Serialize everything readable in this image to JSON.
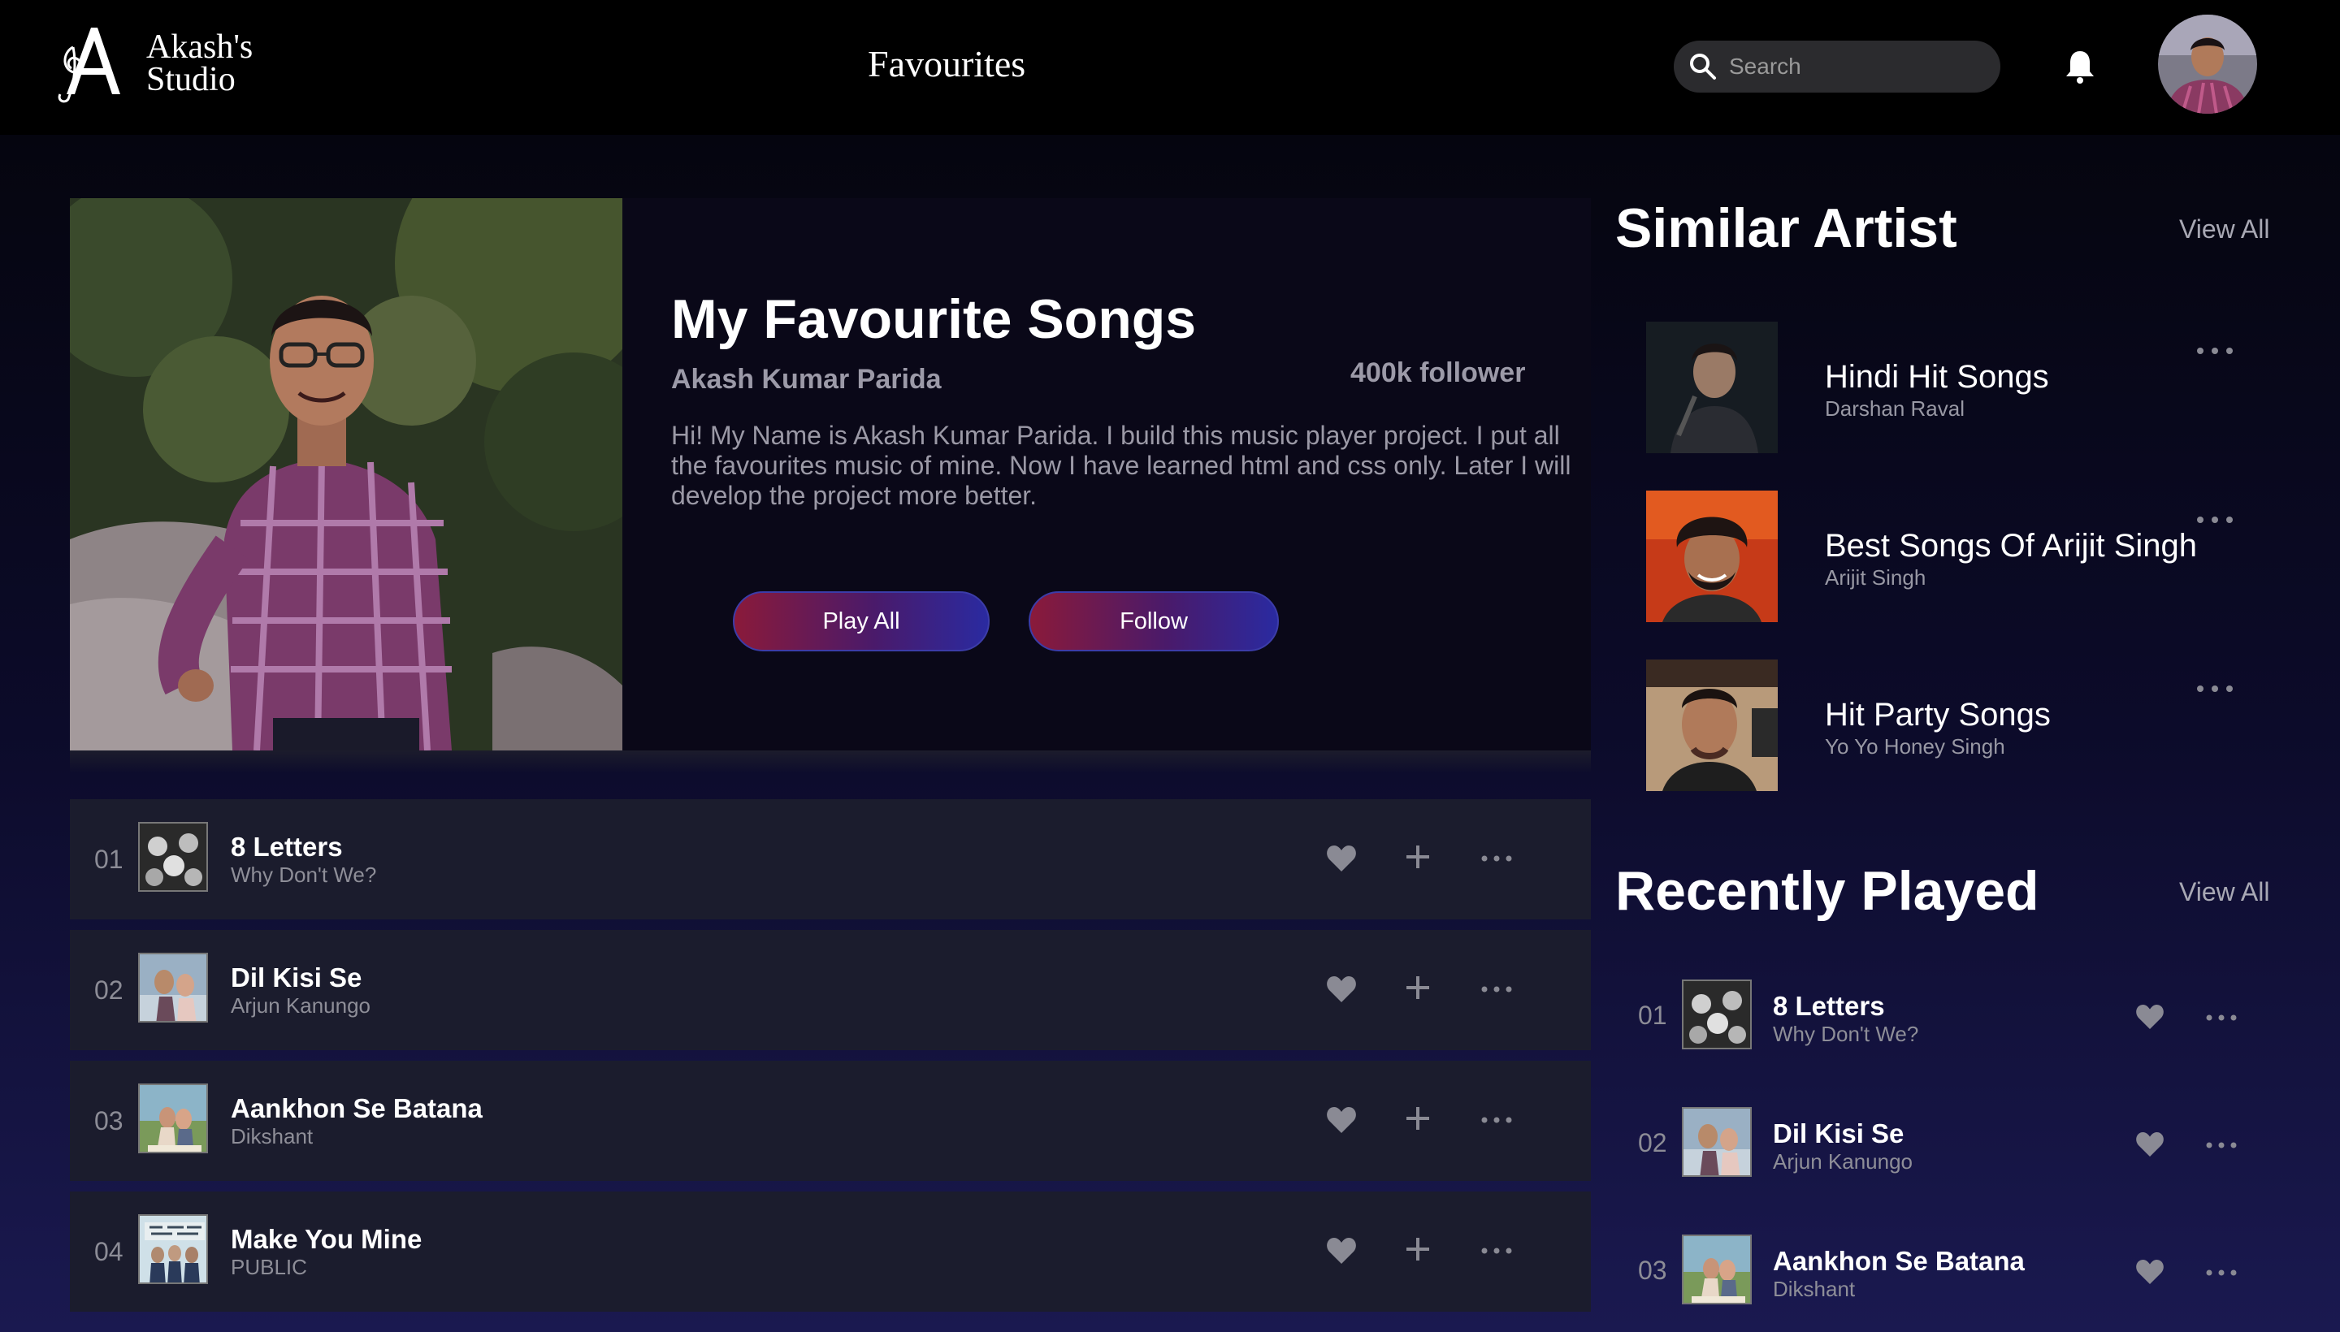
{
  "header": {
    "logo_line1": "Akash's",
    "logo_line2": "Studio",
    "page_title": "Favourites",
    "search_placeholder": "Search"
  },
  "hero": {
    "title": "My Favourite Songs",
    "owner": "Akash Kumar Parida",
    "followers": "400k follower",
    "description": "Hi! My Name is Akash Kumar Parida. I build this music player project. I put all the favourites music of mine. Now I have learned html and css only. Later I will develop the project more better.",
    "play_all_label": "Play All",
    "follow_label": "Follow"
  },
  "songs": [
    {
      "num": "01",
      "title": "8 Letters",
      "artist": "Why Don't We?"
    },
    {
      "num": "02",
      "title": "Dil Kisi Se",
      "artist": "Arjun Kanungo"
    },
    {
      "num": "03",
      "title": "Aankhon Se Batana",
      "artist": "Dikshant"
    },
    {
      "num": "04",
      "title": "Make You Mine",
      "artist": "PUBLIC"
    }
  ],
  "similar_artist": {
    "title": "Similar Artist",
    "view_all": "View All",
    "items": [
      {
        "name": "Hindi Hit Songs",
        "artist": "Darshan Raval"
      },
      {
        "name": "Best Songs Of Arijit Singh",
        "artist": "Arijit Singh"
      },
      {
        "name": "Hit Party Songs",
        "artist": "Yo Yo Honey Singh"
      }
    ]
  },
  "recently_played": {
    "title": "Recently Played",
    "view_all": "View All",
    "items": [
      {
        "num": "01",
        "title": "8 Letters",
        "artist": "Why Don't We?"
      },
      {
        "num": "02",
        "title": "Dil Kisi Se",
        "artist": "Arjun Kanungo"
      },
      {
        "num": "03",
        "title": "Aankhon Se Batana",
        "artist": "Dikshant"
      }
    ]
  },
  "colors": {
    "header_bg": "#000000",
    "row_bg": "#1b1c2d",
    "button_gradient_start": "#8a1a3a",
    "button_gradient_end": "#2a2aa0",
    "muted_text": "#9c9aa8"
  }
}
